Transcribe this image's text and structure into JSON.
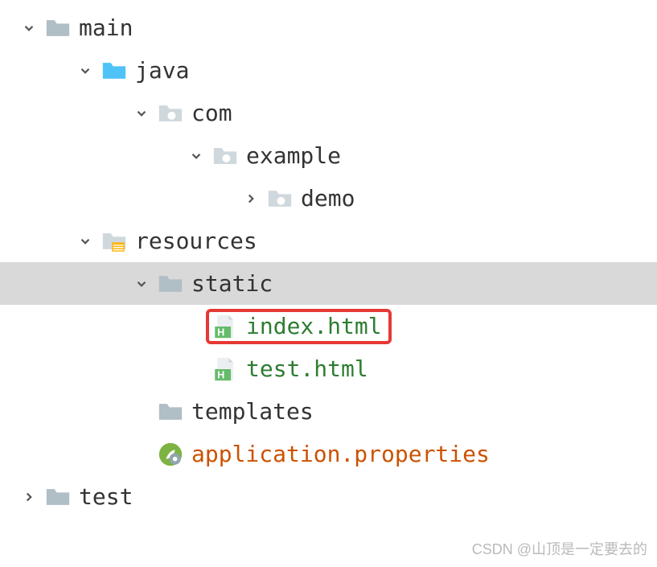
{
  "tree": {
    "main": "main",
    "java": "java",
    "com": "com",
    "example": "example",
    "demo": "demo",
    "resources": "resources",
    "static": "static",
    "index_html": "index.html",
    "test_html": "test.html",
    "templates": "templates",
    "application_properties": "application.properties",
    "test": "test"
  },
  "watermark": "CSDN @山顶是一定要去的",
  "indents": {
    "l0": 20,
    "l1": 90,
    "l2": 160,
    "l3": 228,
    "l4": 296
  }
}
